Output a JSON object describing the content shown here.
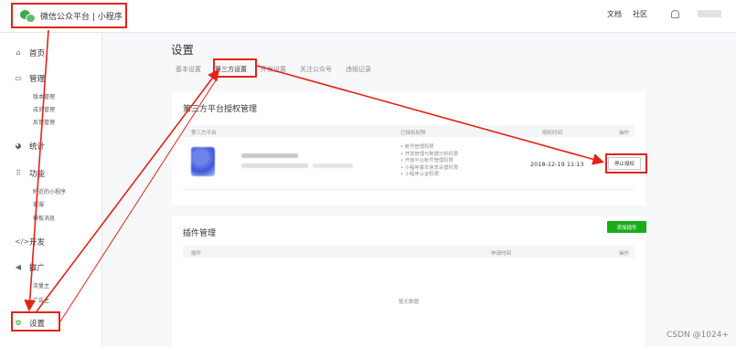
{
  "brand": {
    "name": "微信公众平台 | 小程序"
  },
  "topnav": {
    "docs": "文档",
    "community": "社区"
  },
  "sidebar": {
    "home": "首页",
    "manage": "管理",
    "manage_subs": [
      "版本管理",
      "成员管理",
      "反馈管理"
    ],
    "stats": "统计",
    "features": "功能",
    "features_subs": [
      "附近的小程序",
      "客服",
      "模板消息"
    ],
    "dev": "开发",
    "promote": "推广",
    "promote_subs": [
      "流量主",
      "广告主"
    ],
    "settings": "设置"
  },
  "page": {
    "title": "设置",
    "tabs": [
      "基本设置",
      "第三方设置",
      "开发设置",
      "关注公众号",
      "违规记录"
    ]
  },
  "auth_card": {
    "title": "第三方平台授权管理",
    "headers": [
      "第三方平台",
      "已授权权限",
      "授权时间",
      "操作"
    ],
    "permissions": [
      "帐号管理权限",
      "开发管理与数据分析权限",
      "开放平台帐号管理权限",
      "小程序基本信息设置权限",
      "小程序认证权限"
    ],
    "auth_time": "2018-12-19 11:13",
    "stop_label": "停止授权"
  },
  "plugin_card": {
    "title": "插件管理",
    "add_label": "添加插件",
    "headers": [
      "插件",
      "申请时间",
      "操作"
    ],
    "empty": "暂无数据"
  },
  "watermark": "CSDN @1024+",
  "colors": {
    "accent_green": "#1aad19",
    "annotation_red": "#e2231a"
  }
}
